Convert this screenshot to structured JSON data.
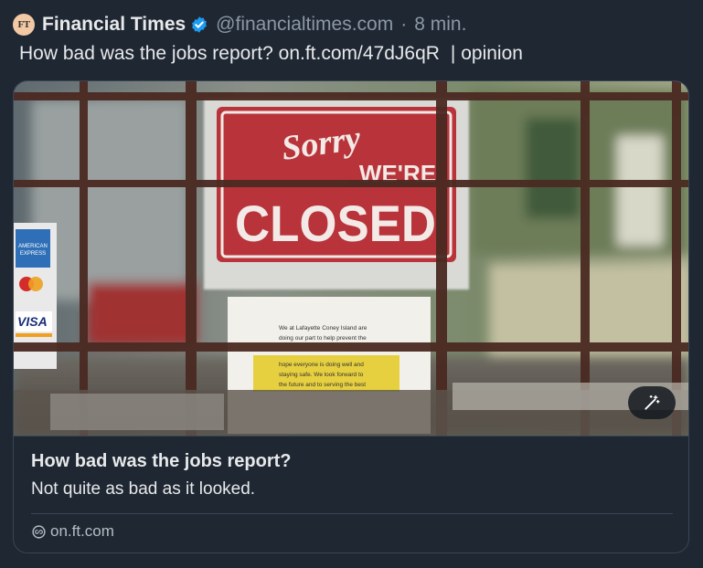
{
  "tweet": {
    "avatar_text": "FT",
    "author_name": "Financial Times",
    "handle": "@financialtimes.com",
    "separator": "·",
    "time": "8 min.",
    "text": "How bad was the jobs report? on.ft.com/47dJ6qR",
    "text_suffix": "| opinion"
  },
  "card": {
    "image_sign": {
      "line1": "Sorry",
      "line2": "WE'RE",
      "line3": "CLOSED"
    },
    "image_notice_lines": [
      "We at Lafayette Coney Island are",
      "doing our part to help prevent the",
      "hope everyone is doing well and",
      "staying safe. We look forward to",
      "the future and to serving the best"
    ],
    "image_card_brands": [
      "AMERICAN EXPRESS",
      "VISA"
    ],
    "title": "How bad was the jobs report?",
    "description": "Not quite as bad as it looked.",
    "domain": "on.ft.com"
  },
  "colors": {
    "background": "#1f2733",
    "verified": "#1d9bf0",
    "sign_red": "#b8343a"
  },
  "icons": [
    "verified-badge-icon",
    "magic-wand-icon",
    "link-icon"
  ]
}
